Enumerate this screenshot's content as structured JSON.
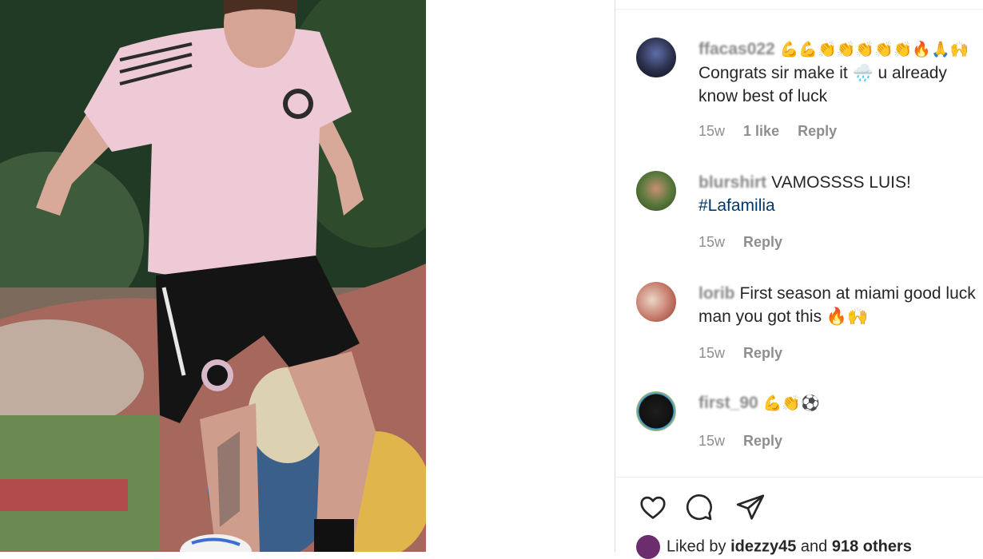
{
  "post": {
    "image_alt": "Soccer player in pink Inter Miami training shirt juggling a ball",
    "shirt_brand": "adidas"
  },
  "comments": [
    {
      "username": "ffacas022",
      "emoji_prefix": "💪💪👏👏👏👏👏🔥🙏🙌",
      "text": "Congrats sir make it 🌧️ u already know best of luck",
      "time": "15w",
      "likes": "1 like",
      "reply": "Reply"
    },
    {
      "username": "blurshirt",
      "text": "VAMOSSSS LUIS!",
      "hashtag": "#Lafamilia",
      "time": "15w",
      "reply": "Reply"
    },
    {
      "username": "lorib",
      "text": "First season at miami good luck man you got this 🔥🙌",
      "time": "15w",
      "reply": "Reply"
    },
    {
      "username": "first_90",
      "text": "💪👏⚽",
      "time": "15w",
      "reply": "Reply"
    }
  ],
  "actions": {
    "like_icon": "heart-icon",
    "comment_icon": "comment-icon",
    "share_icon": "paper-plane-icon"
  },
  "likes_summary": {
    "prefix": "Liked by",
    "user": "idezzy45",
    "conj": "and",
    "others": "918 others"
  },
  "colors": {
    "hashtag": "#00376b",
    "meta_gray": "#8e8e8e",
    "text": "#262626"
  }
}
